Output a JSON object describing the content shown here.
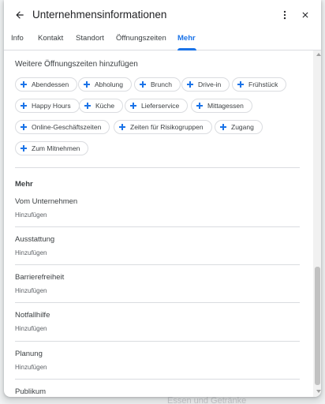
{
  "backdrop": {
    "text": "Essen und Getränke"
  },
  "header": {
    "title": "Unternehmensinformationen"
  },
  "tabs": [
    {
      "label": "Info"
    },
    {
      "label": "Kontakt"
    },
    {
      "label": "Standort"
    },
    {
      "label": "Öffnungszeiten"
    },
    {
      "label": "Mehr",
      "active": true
    }
  ],
  "hours_section": {
    "title": "Weitere Öffnungszeiten hinzufügen",
    "chips": [
      {
        "label": "Abendessen"
      },
      {
        "label": "Abholung"
      },
      {
        "label": "Brunch"
      },
      {
        "label": "Drive-in"
      },
      {
        "label": "Frühstück"
      },
      {
        "label": "Happy Hours"
      },
      {
        "label": "Küche"
      },
      {
        "label": "Lieferservice"
      },
      {
        "label": "Mittagessen"
      },
      {
        "label": "Online-Geschäftszeiten"
      },
      {
        "label": "Zeiten für Risikogruppen"
      },
      {
        "label": "Zugang"
      },
      {
        "label": "Zum Mitnehmen"
      }
    ]
  },
  "more_section": {
    "title": "Mehr",
    "rows": [
      {
        "label": "Vom Unternehmen",
        "value": "Hinzufügen"
      },
      {
        "label": "Ausstattung",
        "value": "Hinzufügen"
      },
      {
        "label": "Barrierefreiheit",
        "value": "Hinzufügen"
      },
      {
        "label": "Notfallhilfe",
        "value": "Hinzufügen"
      },
      {
        "label": "Planung",
        "value": "Hinzufügen"
      },
      {
        "label": "Publikum",
        "value": ""
      }
    ]
  },
  "colors": {
    "accent": "#1a73e8",
    "text_primary": "#202124",
    "text_secondary": "#5f6368",
    "divider": "#dadce0"
  }
}
